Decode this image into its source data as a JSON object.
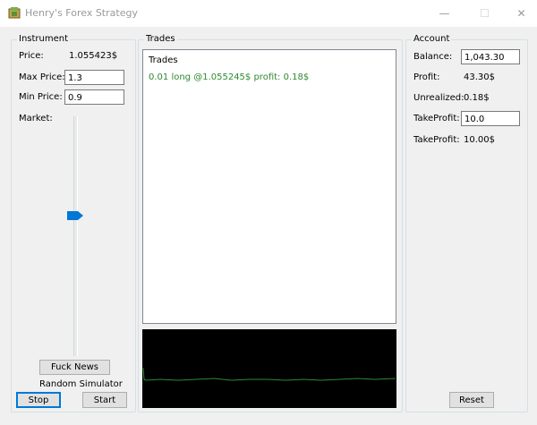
{
  "window": {
    "title": "Henry's Forex Strategy",
    "minimize_glyph": "—",
    "maximize_glyph": "☐",
    "close_glyph": "✕"
  },
  "instrument": {
    "legend": "Instrument",
    "price_label": "Price:",
    "price_value": "1.055423$",
    "max_price_label": "Max Price:",
    "max_price_value": "1.3",
    "min_price_label": "Min Price:",
    "min_price_value": "0.9",
    "market_label": "Market:",
    "market_level": 0.59,
    "fuck_news_label": "Fuck News",
    "random_simulator_label": "Random Simulator",
    "stop_label": "Stop",
    "start_label": "Start"
  },
  "trades": {
    "legend": "Trades",
    "list_header": "Trades",
    "items": [
      "0.01 long @1.055245$ profit: 0.18$"
    ],
    "item_color": "#2e8b2e"
  },
  "account": {
    "legend": "Account",
    "balance_label": "Balance:",
    "balance_value": "1,043.30",
    "profit_label": "Profit:",
    "profit_value": "43.30$",
    "unrealized_label": "Unrealized:",
    "unrealized_value": "0.18$",
    "take_profit_label": "TakeProfit:",
    "take_profit_input": "10.0",
    "take_profit_label_2": "TakeProfit:",
    "take_profit_value_2": "10.00$",
    "reset_label": "Reset"
  },
  "colors": {
    "accent": "#0078d7",
    "chart_bg": "#000000",
    "chart_line": "#2e8b2e"
  }
}
